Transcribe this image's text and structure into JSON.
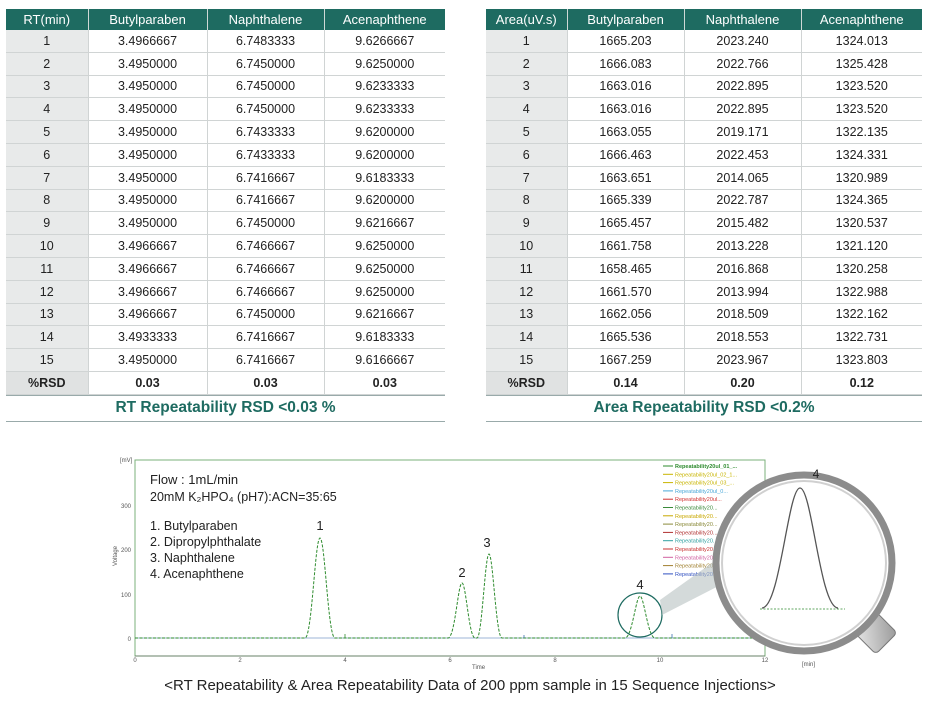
{
  "rt_table": {
    "headers": [
      "RT(min)",
      "Butylparaben",
      "Naphthalene",
      "Acenaphthene"
    ],
    "rows": [
      [
        "1",
        "3.4966667",
        "6.7483333",
        "9.6266667"
      ],
      [
        "2",
        "3.4950000",
        "6.7450000",
        "9.6250000"
      ],
      [
        "3",
        "3.4950000",
        "6.7450000",
        "9.6233333"
      ],
      [
        "4",
        "3.4950000",
        "6.7450000",
        "9.6233333"
      ],
      [
        "5",
        "3.4950000",
        "6.7433333",
        "9.6200000"
      ],
      [
        "6",
        "3.4950000",
        "6.7433333",
        "9.6200000"
      ],
      [
        "7",
        "3.4950000",
        "6.7416667",
        "9.6183333"
      ],
      [
        "8",
        "3.4950000",
        "6.7416667",
        "9.6200000"
      ],
      [
        "9",
        "3.4950000",
        "6.7450000",
        "9.6216667"
      ],
      [
        "10",
        "3.4966667",
        "6.7466667",
        "9.6250000"
      ],
      [
        "11",
        "3.4966667",
        "6.7466667",
        "9.6250000"
      ],
      [
        "12",
        "3.4966667",
        "6.7466667",
        "9.6250000"
      ],
      [
        "13",
        "3.4966667",
        "6.7450000",
        "9.6216667"
      ],
      [
        "14",
        "3.4933333",
        "6.7416667",
        "9.6183333"
      ],
      [
        "15",
        "3.4950000",
        "6.7416667",
        "9.6166667"
      ],
      [
        "%RSD",
        "0.03",
        "0.03",
        "0.03"
      ]
    ],
    "caption": "RT Repeatability RSD <0.03 %"
  },
  "area_table": {
    "headers": [
      "Area(uV.s)",
      "Butylparaben",
      "Naphthalene",
      "Acenaphthene"
    ],
    "rows": [
      [
        "1",
        "1665.203",
        "2023.240",
        "1324.013"
      ],
      [
        "2",
        "1666.083",
        "2022.766",
        "1325.428"
      ],
      [
        "3",
        "1663.016",
        "2022.895",
        "1323.520"
      ],
      [
        "4",
        "1663.016",
        "2022.895",
        "1323.520"
      ],
      [
        "5",
        "1663.055",
        "2019.171",
        "1322.135"
      ],
      [
        "6",
        "1666.463",
        "2022.453",
        "1324.331"
      ],
      [
        "7",
        "1663.651",
        "2014.065",
        "1320.989"
      ],
      [
        "8",
        "1665.339",
        "2022.787",
        "1324.365"
      ],
      [
        "9",
        "1665.457",
        "2015.482",
        "1320.537"
      ],
      [
        "10",
        "1661.758",
        "2013.228",
        "1321.120"
      ],
      [
        "11",
        "1658.465",
        "2016.868",
        "1320.258"
      ],
      [
        "12",
        "1661.570",
        "2013.994",
        "1322.988"
      ],
      [
        "13",
        "1662.056",
        "2018.509",
        "1322.162"
      ],
      [
        "14",
        "1665.536",
        "2018.553",
        "1322.731"
      ],
      [
        "15",
        "1667.259",
        "2023.967",
        "1323.803"
      ],
      [
        "%RSD",
        "0.14",
        "0.20",
        "0.12"
      ]
    ],
    "caption": "Area Repeatability RSD <0.2%"
  },
  "chromatogram": {
    "y_unit": "[mV]",
    "y_label": "Voltage",
    "x_label": "Time",
    "x_unit": "[min]",
    "y_ticks": [
      "0",
      "100",
      "200",
      "300"
    ],
    "x_ticks": [
      "0",
      "2",
      "4",
      "6",
      "8",
      "10",
      "12"
    ],
    "conditions": [
      "Flow : 1mL/min",
      "20mM K₂HPO₄ (pH7):ACN=35:65"
    ],
    "compounds": [
      "1. Butylparaben",
      "2. Dipropylphthalate",
      "3. Naphthalene",
      "4. Acenaphthene"
    ],
    "peak_labels": [
      "1",
      "2",
      "3",
      "4"
    ],
    "zoom_label": "4",
    "legend": [
      {
        "name": "Repeatability20ul_01_...",
        "color": "#2e8b2e",
        "bold": true
      },
      {
        "name": "Repeatability20ul_02_1...",
        "color": "#c8b400"
      },
      {
        "name": "Repeatability20ul_03_...",
        "color": "#c8b400"
      },
      {
        "name": "Repeatability20ul_0...",
        "color": "#4aa8d8"
      },
      {
        "name": "Repeatability20ul...",
        "color": "#d03030"
      },
      {
        "name": "Repeatability20...",
        "color": "#3a8a3a"
      },
      {
        "name": "Repeatability20...",
        "color": "#c8a800"
      },
      {
        "name": "Repeatability20...",
        "color": "#8a8a3a"
      },
      {
        "name": "Repeatability20...",
        "color": "#b03030"
      },
      {
        "name": "Repeatability20...",
        "color": "#30a0a0"
      },
      {
        "name": "Repeatability20...",
        "color": "#c83030"
      },
      {
        "name": "Repeatability20...",
        "color": "#d060a0"
      },
      {
        "name": "Repeatability20...",
        "color": "#a08030"
      },
      {
        "name": "Repeatability20...",
        "color": "#3050c0"
      }
    ],
    "colors": {
      "trace": "#2e8b2e",
      "frame": "#7bb07b",
      "accent": "#1e6b61"
    }
  },
  "footer": "<RT Repeatability & Area Repeatability Data of 200 ppm sample in 15 Sequence Injections>"
}
